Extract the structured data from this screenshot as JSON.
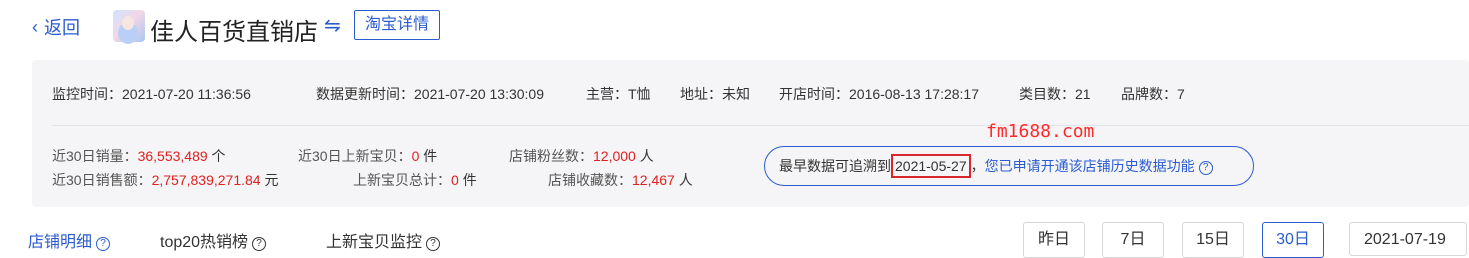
{
  "header": {
    "back_label": "返回",
    "back_icon": "chevron-left-icon",
    "shop_name": "佳人百货直销店",
    "switch_icon": "swap-icon",
    "taobao_detail_label": "淘宝详情"
  },
  "info_row1": {
    "monitor_time_label": "监控时间：",
    "monitor_time": "2021-07-20 11:36:56",
    "update_time_label": "数据更新时间：",
    "update_time": "2021-07-20 13:30:09",
    "main_category_label": "主营：",
    "main_category": "T恤",
    "address_label": "地址：",
    "address": "未知",
    "open_time_label": "开店时间：",
    "open_time": "2016-08-13 17:28:17",
    "category_count_label": "类目数：",
    "category_count": "21",
    "brand_count_label": "品牌数：",
    "brand_count": "7"
  },
  "stats": {
    "sales_30d_label": "近30日销量：",
    "sales_30d": "36,553,489",
    "sales_30d_unit": "个",
    "revenue_30d_label": "近30日销售额：",
    "revenue_30d": "2,757,839,271.84",
    "revenue_30d_unit": "元",
    "new_items_30d_label": "近30日上新宝贝：",
    "new_items_30d": "0",
    "new_items_30d_unit": "件",
    "new_items_total_label": "上新宝贝总计：",
    "new_items_total": "0",
    "new_items_total_unit": "件",
    "fans_label": "店铺粉丝数：",
    "fans": "12,000",
    "fans_unit": "人",
    "favorites_label": "店铺收藏数：",
    "favorites": "12,467",
    "favorites_unit": "人"
  },
  "notice": {
    "prefix": "最早数据可追溯到",
    "date": "2021-05-27",
    "separator": "，",
    "link": "您已申请开通该店铺历史数据功能",
    "help_icon": "question-circle-icon"
  },
  "watermark": "fm1688.com",
  "tabs": [
    {
      "label": "店铺明细",
      "help": "?"
    },
    {
      "label": "top20热销榜",
      "help": "?"
    },
    {
      "label": "上新宝贝监控",
      "help": "?"
    }
  ],
  "range_buttons": [
    "昨日",
    "7日",
    "15日",
    "30日"
  ],
  "active_range": "30日",
  "date_value": "2021-07-19",
  "colors": {
    "accent": "#2b5ccf",
    "highlight_red": "#e02020",
    "panel_bg": "#f5f5f7"
  }
}
